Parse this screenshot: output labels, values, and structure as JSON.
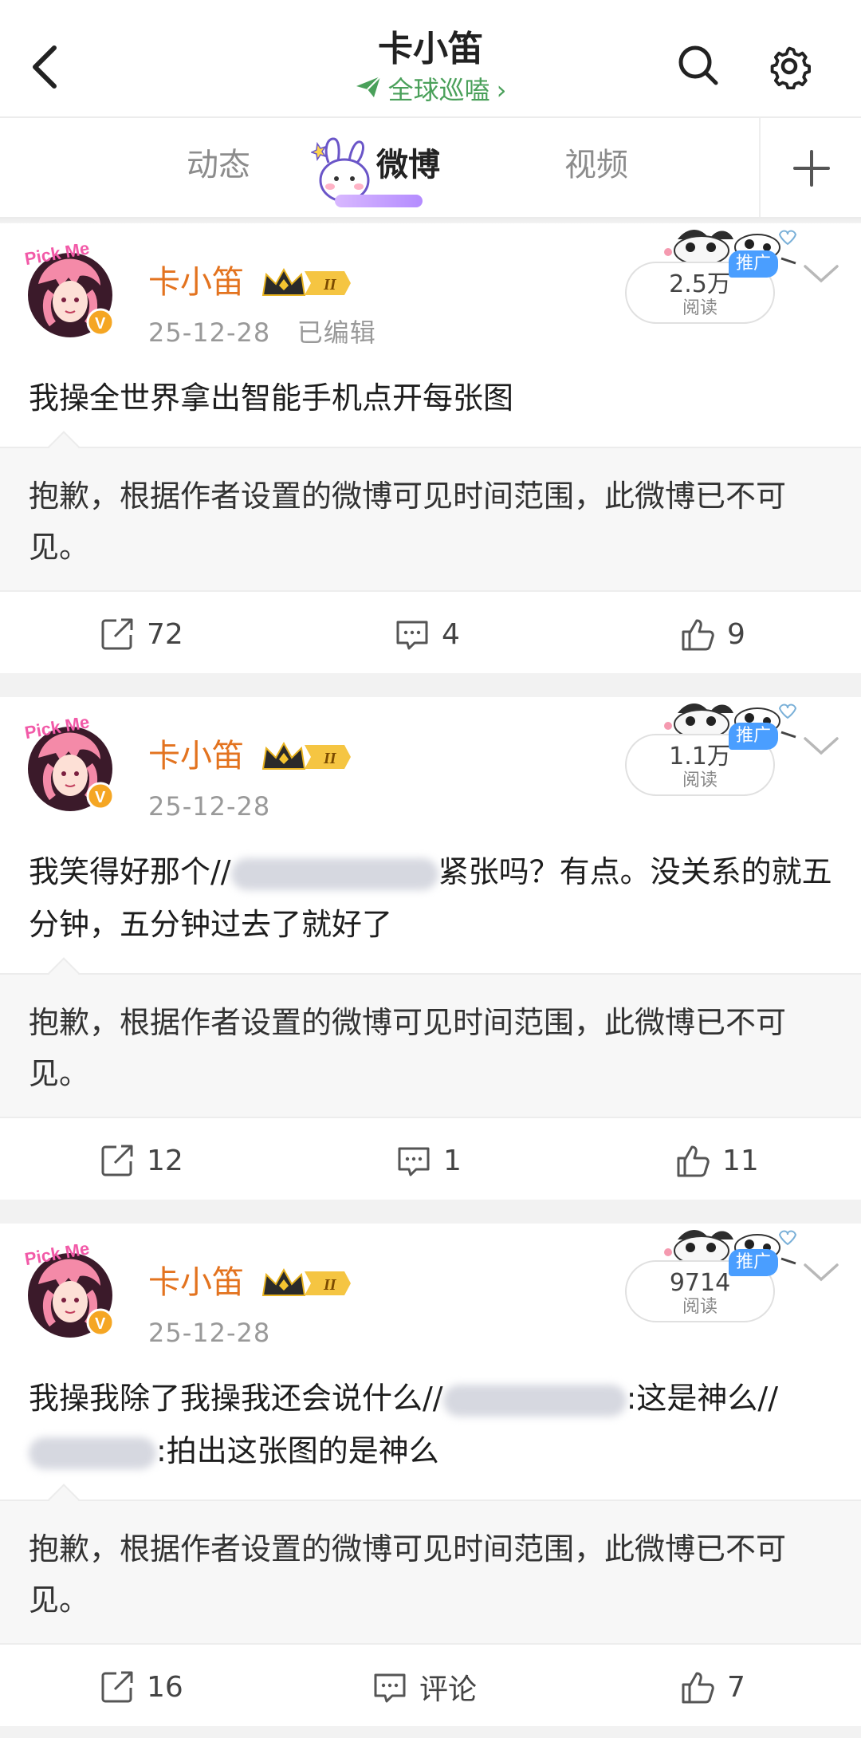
{
  "header": {
    "title": "卡小笛",
    "subtitle": "全球巡嗑",
    "subtitle_chevron": "›",
    "icons": [
      "back-arrow-icon",
      "send-plane-icon",
      "search-icon",
      "gear-icon"
    ]
  },
  "tabs": {
    "items": [
      "动态",
      "微博",
      "视频"
    ],
    "active": "微博",
    "plus_label": "+"
  },
  "colors": {
    "username": "#e3731f",
    "subtitle_green": "#4aa05a",
    "promo_blue": "#4a9eff",
    "separator": "#f2f2f2"
  },
  "posts": [
    {
      "user": "卡小笛",
      "level_badge": "II",
      "date": "25-12-28",
      "edited": "已编辑",
      "read_count": "2.5万",
      "read_label": "阅读",
      "promo": "推广",
      "text": "我操全世界拿出智能手机点开每张图",
      "retweet_notice": "抱歉，根据作者设置的微博可见时间范围，此微博已不可见。",
      "repost": "72",
      "comment": "4",
      "like": "9"
    },
    {
      "user": "卡小笛",
      "level_badge": "II",
      "date": "25-12-28",
      "read_count": "1.1万",
      "read_label": "阅读",
      "promo": "推广",
      "text_a": "我笑得好那个//",
      "text_b": "紧张吗？有点。没关系的就五分钟，五分钟过去了就好了",
      "retweet_notice": "抱歉，根据作者设置的微博可见时间范围，此微博已不可见。",
      "repost": "12",
      "comment": "1",
      "like": "11"
    },
    {
      "user": "卡小笛",
      "level_badge": "II",
      "date": "25-12-28",
      "read_count": "9714",
      "read_label": "阅读",
      "promo": "推广",
      "text_a": "我操我除了我操我还会说什么//",
      "text_b": ":这是神么//",
      "text_c": ":拍出这张图的是神么",
      "retweet_notice": "抱歉，根据作者设置的微博可见时间范围，此微博已不可见。",
      "repost": "16",
      "comment": "评论",
      "like": "7"
    }
  ]
}
